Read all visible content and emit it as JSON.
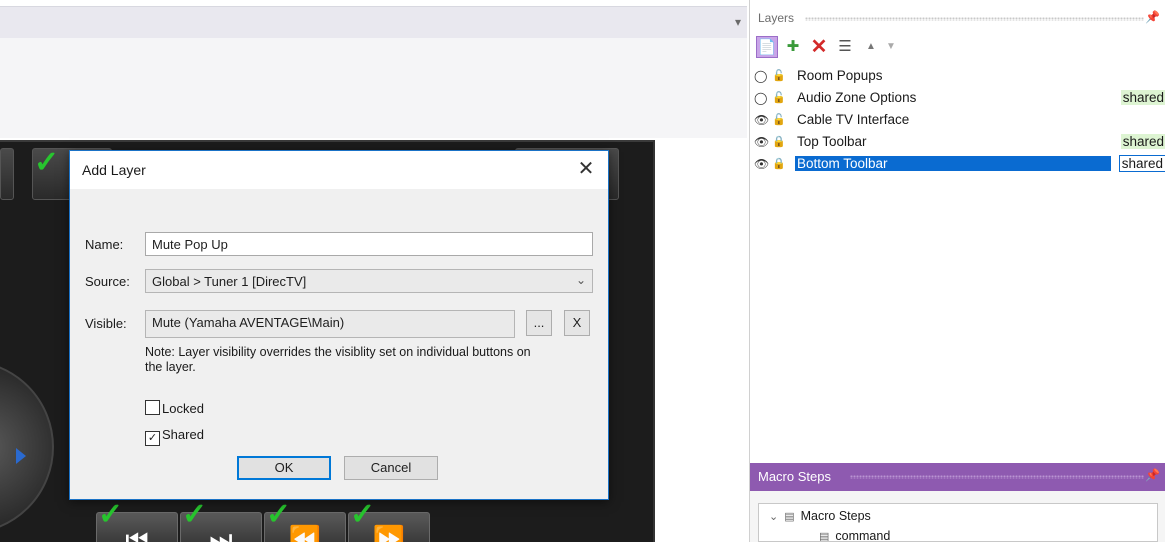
{
  "dialog": {
    "title": "Add Layer",
    "close_glyph": "✕",
    "name_label": "Name:",
    "name_value": "Mute Pop Up",
    "source_label": "Source:",
    "source_value": "Global > Tuner 1 [DirecTV]",
    "visible_label": "Visible:",
    "visible_value": "Mute (Yamaha AVENTAGE\\Main)",
    "browse_label": "...",
    "clear_label": "X",
    "note": "Note: Layer visibility overrides the visiblity set on individual buttons on the layer.",
    "locked_label": "Locked",
    "locked_checked": false,
    "shared_label": "Shared",
    "shared_checked": true,
    "ok_label": "OK",
    "cancel_label": "Cancel"
  },
  "layers_panel": {
    "title": "Layers",
    "toolbar_icons": [
      "new-layer-icon",
      "new-shared-layer-icon",
      "delete-icon",
      "properties-icon",
      "move-up-icon",
      "move-down-icon"
    ],
    "layers": [
      {
        "name": "Room Popups",
        "visible": false,
        "locked": false,
        "shared": "",
        "selected": false
      },
      {
        "name": "Audio Zone Options",
        "visible": false,
        "locked": false,
        "shared": "shared",
        "selected": false
      },
      {
        "name": "Cable TV Interface",
        "visible": true,
        "locked": false,
        "shared": "",
        "selected": false
      },
      {
        "name": "Top Toolbar",
        "visible": true,
        "locked": true,
        "shared": "shared",
        "selected": false
      },
      {
        "name": "Bottom Toolbar",
        "visible": true,
        "locked": true,
        "shared": "shared",
        "selected": true
      }
    ]
  },
  "macro_panel": {
    "title": "Macro Steps",
    "tree_root": "Macro Steps",
    "tree_child": "command"
  },
  "colors": {
    "accent_purple": "#8e5ab0",
    "selection_blue": "#0a6bd1",
    "shared_badge": "#ddf4d2",
    "check_green": "#27c52e"
  }
}
